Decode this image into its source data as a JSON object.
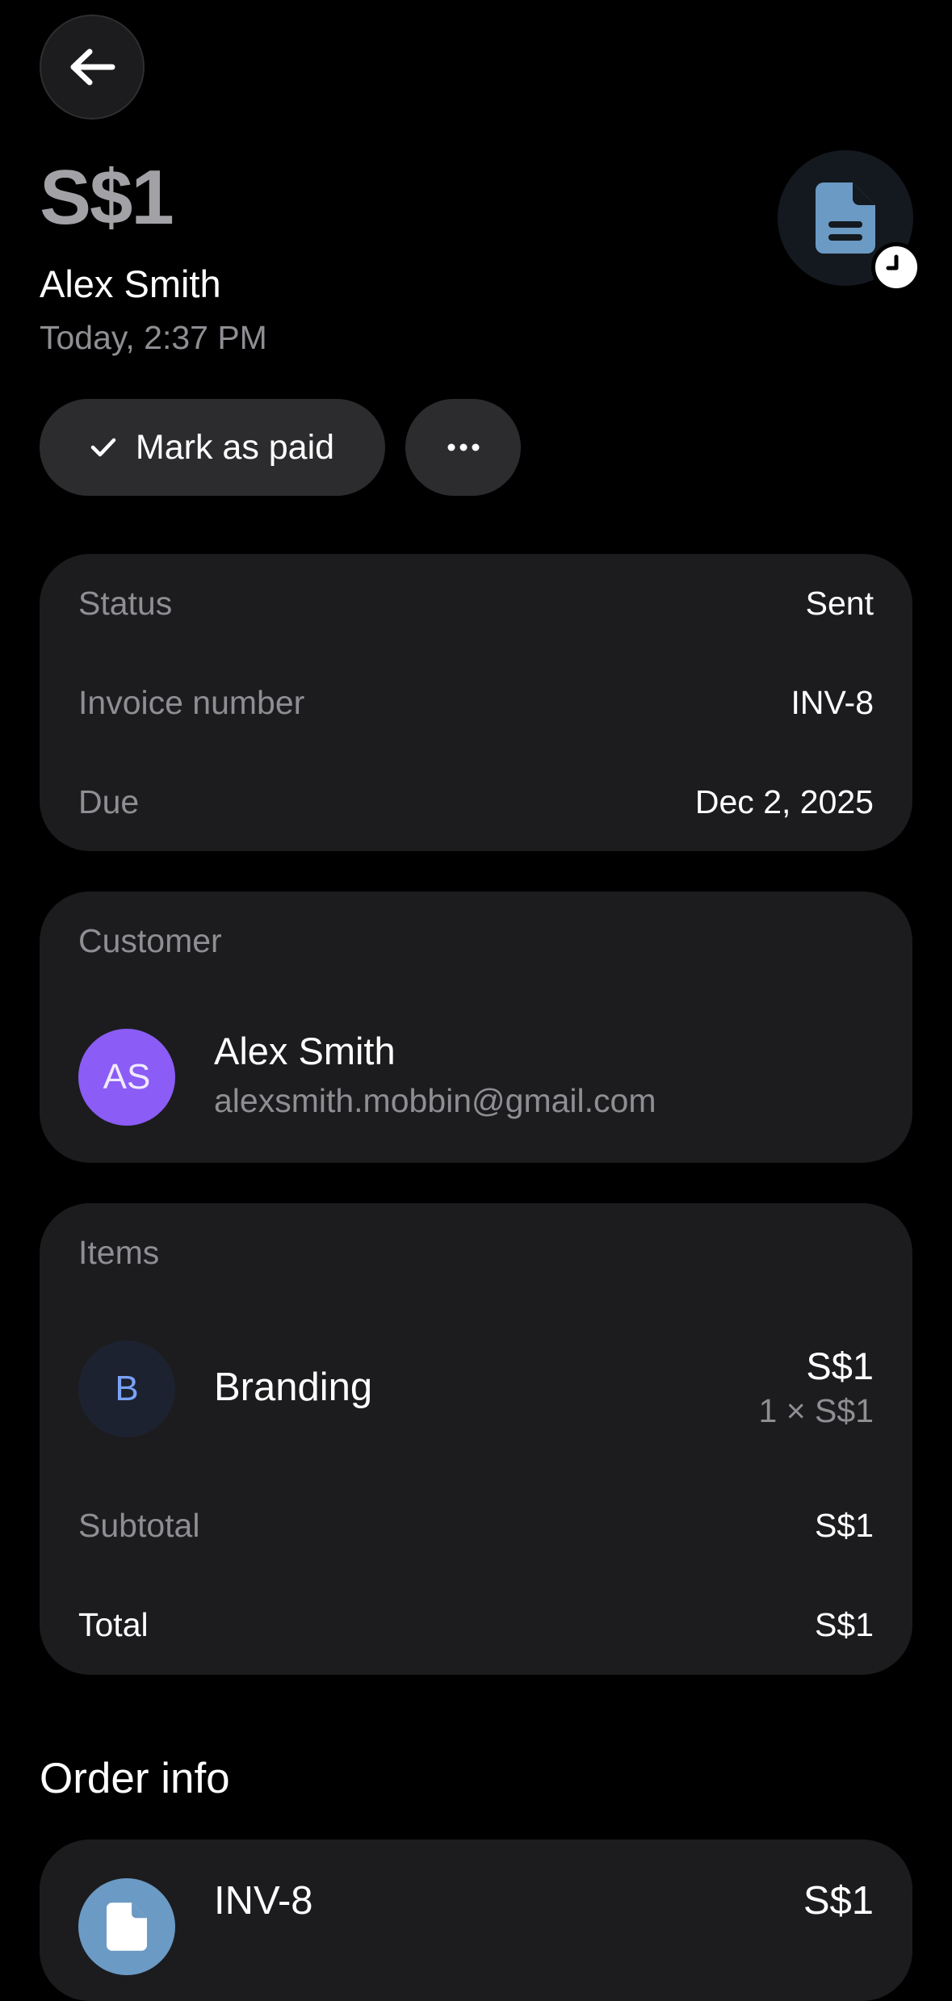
{
  "header": {
    "amount": "S$1",
    "customer_name": "Alex Smith",
    "date": "Today, 2:37 PM",
    "back_icon": "arrow-left-icon",
    "document_icon": "document-icon",
    "clock_icon": "clock-icon"
  },
  "actions": {
    "mark_paid_label": "Mark as paid",
    "more_icon": "more-horizontal-icon"
  },
  "details": {
    "status_label": "Status",
    "status_value": "Sent",
    "invoice_label": "Invoice number",
    "invoice_value": "INV-8",
    "due_label": "Due",
    "due_value": "Dec 2, 2025"
  },
  "customer": {
    "section_label": "Customer",
    "initials": "AS",
    "name": "Alex Smith",
    "email": "alexsmith.mobbin@gmail.com"
  },
  "items": {
    "section_label": "Items",
    "list": [
      {
        "initial": "B",
        "name": "Branding",
        "price": "S$1",
        "qty_line": "1 × S$1"
      }
    ],
    "subtotal_label": "Subtotal",
    "subtotal_value": "S$1",
    "total_label": "Total",
    "total_value": "S$1"
  },
  "order_info": {
    "title": "Order info",
    "entry_label": "INV-8",
    "entry_amount": "S$1"
  },
  "colors": {
    "background": "#000000",
    "card": "#1c1c1e",
    "pill": "#2c2c2e",
    "muted_text": "#8e8e93",
    "customer_avatar": "#8b5cf6",
    "item_avatar_bg": "#1d2230",
    "item_avatar_text": "#7aa2f7",
    "document_icon": "#6b9ac4"
  }
}
